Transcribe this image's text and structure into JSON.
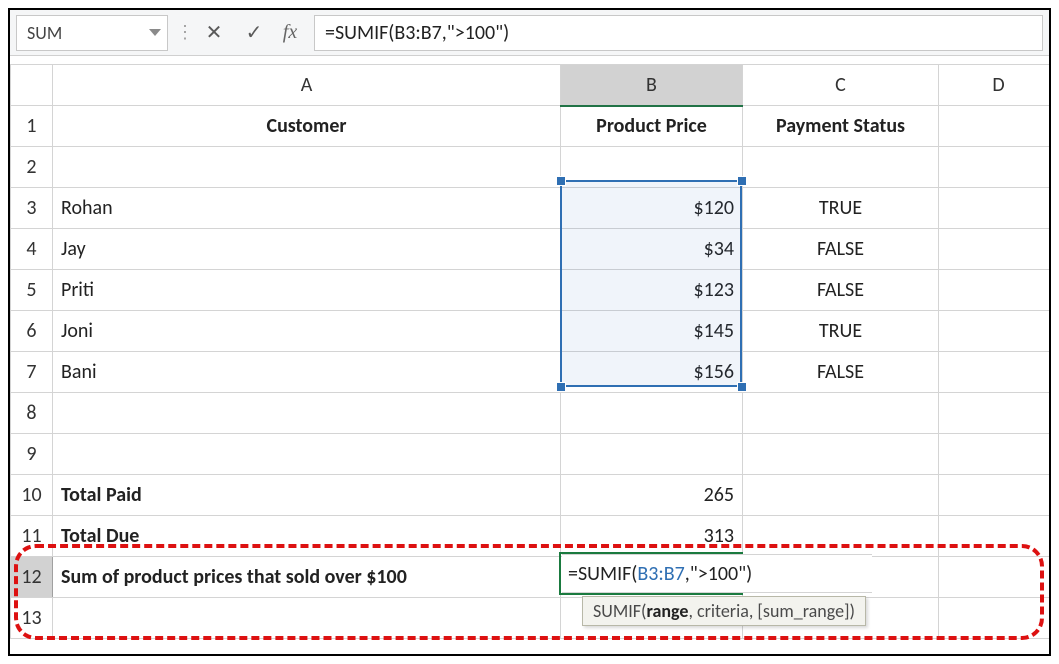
{
  "name_box": {
    "value": "SUM"
  },
  "formula_bar": {
    "cancel_icon": "✕",
    "enter_icon": "✓",
    "fx_label": "fx",
    "formula": "=SUMIF(B3:B7,\">100\")"
  },
  "columns": [
    "A",
    "B",
    "C",
    "D"
  ],
  "row_numbers": [
    "1",
    "2",
    "3",
    "4",
    "5",
    "6",
    "7",
    "8",
    "9",
    "10",
    "11",
    "12",
    "13"
  ],
  "headers": {
    "A": "Customer",
    "B": "Product Price",
    "C": "Payment Status"
  },
  "rows": [
    {
      "customer": "Rohan",
      "price": "$120",
      "status": "TRUE"
    },
    {
      "customer": "Jay",
      "price": "$34",
      "status": "FALSE"
    },
    {
      "customer": "Priti",
      "price": "$123",
      "status": "FALSE"
    },
    {
      "customer": "Joni",
      "price": "$145",
      "status": "TRUE"
    },
    {
      "customer": "Bani",
      "price": "$156",
      "status": "FALSE"
    }
  ],
  "summary": {
    "total_paid_label": "Total Paid",
    "total_paid_value": "265",
    "total_due_label": "Total Due",
    "total_due_value": "313",
    "sum_over_label": "Sum of product prices that sold over $100"
  },
  "editing_cell": {
    "address": "B12",
    "prefix": "=SUMIF(",
    "range_ref": "B3:B7",
    "suffix": ",\">100\")"
  },
  "tooltip": {
    "fn": "SUMIF",
    "sig_bold": "range",
    "sig_rest": ", criteria, [sum_range])"
  },
  "chart_data": {
    "type": "table",
    "title": "",
    "columns": [
      "Customer",
      "Product Price",
      "Payment Status"
    ],
    "rows": [
      [
        "Rohan",
        120,
        true
      ],
      [
        "Jay",
        34,
        false
      ],
      [
        "Priti",
        123,
        false
      ],
      [
        "Joni",
        145,
        true
      ],
      [
        "Bani",
        156,
        false
      ]
    ],
    "totals": {
      "Total Paid": 265,
      "Total Due": 313
    },
    "formula_shown": "=SUMIF(B3:B7,\">100\")"
  }
}
